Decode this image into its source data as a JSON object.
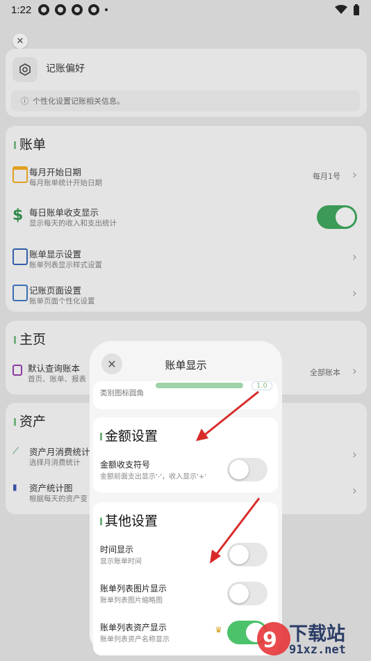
{
  "status_bar": {
    "time": "1:22"
  },
  "prefs": {
    "title": "记账偏好",
    "info": "个性化设置记账相关信息。"
  },
  "bill": {
    "title": "账单",
    "rows": [
      {
        "title": "每月开始日期",
        "subtitle": "每月账单统计开始日期",
        "value": "每月1号"
      },
      {
        "title": "每日账单收支显示",
        "subtitle": "显示每天的收入和支出统计",
        "toggle": true
      },
      {
        "title": "账单显示设置",
        "subtitle": "账单列表显示样式设置"
      },
      {
        "title": "记账页面设置",
        "subtitle": "账单页面个性化设置"
      }
    ]
  },
  "home": {
    "title": "主页",
    "rows": [
      {
        "title": "默认查询账本",
        "subtitle": "首页、账单、报表",
        "value": "全部账本"
      }
    ]
  },
  "assets": {
    "title": "资产",
    "rows": [
      {
        "title": "资产月消费统计",
        "subtitle": "选择月消费统计"
      },
      {
        "title": "资产统计图",
        "subtitle": "根据每天的资产变"
      }
    ]
  },
  "modal": {
    "title": "账单显示",
    "slider": {
      "label": "类别图标圆角",
      "value": "1.0"
    },
    "amount": {
      "title": "金额设置",
      "row_title": "金额收支符号",
      "row_subtitle": "金额前面支出显示'-'，收入显示'+'",
      "on": false
    },
    "other": {
      "title": "其他设置",
      "rows": [
        {
          "title": "时间显示",
          "subtitle": "显示账单时间",
          "on": false
        },
        {
          "title": "账单列表图片显示",
          "subtitle": "账单列表图片缩略图",
          "on": false
        },
        {
          "title": "账单列表资产显示",
          "subtitle": "账单列表资产名称显示",
          "on": true
        }
      ]
    }
  },
  "watermark": {
    "line1": "下载站",
    "line2": "91xz.net"
  },
  "colors": {
    "accent_green": "#4cc26b",
    "annotation_red": "#d92a2a"
  }
}
